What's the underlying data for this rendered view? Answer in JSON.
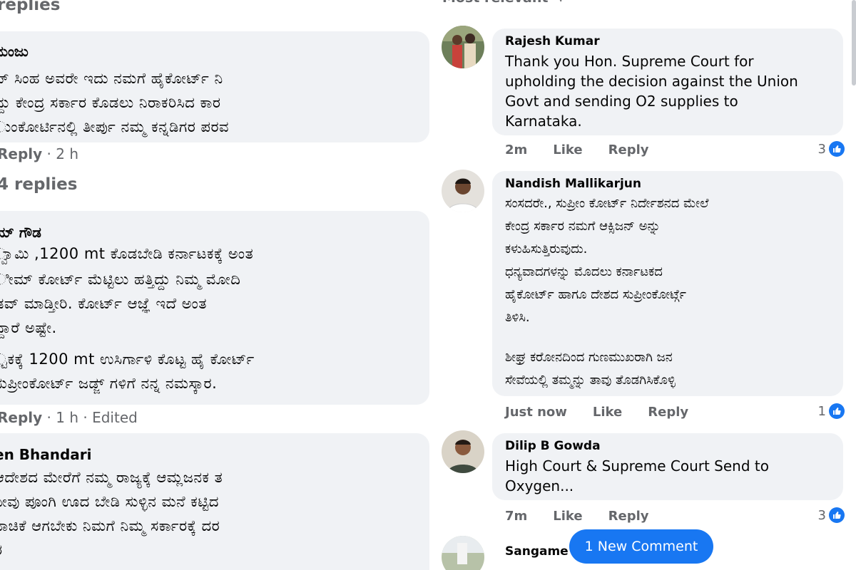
{
  "left": {
    "top_replies": "replies",
    "comment1": {
      "name": "ಮಂಜು",
      "lines": [
        "ಪ್ ಸಿಂಹ ಅವರೇ ಇದು ನಮಗೆ ಹೈಕೋರ್ಟ್ ನಿ",
        "ದ್ದು ಕೇಂದ್ರ ಸರ್ಕಾರ ಕೊಡಲು ನಿರಾಕರಿಸಿದ ಕಾರ",
        "ುಂಕೋರ್ಟಿನಲ್ಲಿ ತೀರ್ಪು ನಮ್ಮ ಕನ್ನಡಿಗರ ಪರವ"
      ],
      "reply": "Reply",
      "time": "· 2 h"
    },
    "replies2": "4 replies",
    "comment2": {
      "name": "ಯ್ ಗೌಡ",
      "lines": [
        "್ವಾಮಿ ,1200 mt ಕೊಡಬೇಡಿ ಕರ್ನಾಟಕಕ್ಕೆ ಅಂತ",
        "ೀಮ್ ಕೋರ್ಟ್ ಮೆಟ್ಟಿಲು ಹತ್ತಿದ್ದು ನಿಮ್ಮ ಮೋದಿ",
        "ಡವ್ ಮಾಡ್ತೀರಿ. ಕೋರ್ಟ್ ಆಜ್ಞೆ ಇದೆ ಅಂತ",
        "ದ್ದಾರೆ ಅಷ್ಟೇ.",
        "",
        "್ಟಕಕ್ಕೆ 1200 mt ಉಸಿರ್ಗಾಳಿ ಕೊಟ್ಟ ಹೈ ಕೋರ್ಟ್",
        "ಸುಪ್ರೀಂಕೋರ್ಟ್ ಜಡ್ಜ್ ಗಳಿಗೆ ನನ್ನ ನಮಸ್ಕಾರ."
      ],
      "reply": "Reply",
      "time": "· 1 h · Edited"
    },
    "comment3": {
      "name": "en Bhandari",
      "lines": [
        "ಆದೇಶದ ಮೇರೆಗೆ ನಮ್ಮ ರಾಜ್ಯಕ್ಕೆ ಆಮ್ಲಜನಕ ತ",
        "ನೀವು ಪೂಂಗಿ ಊದ ಬೇಡಿ ಸುಳ್ಳಿನ ಮನೆ ಕಟ್ಟಿದ",
        "ನಾಚಿಕೆ ಆಗಬೇಕು ನಿಮಗೆ ನಿಮ್ಮ ಸರ್ಕಾರಕ್ಕೆ ದರ",
        "ರ"
      ]
    }
  },
  "right": {
    "sort_label": "Most relevant",
    "comments": [
      {
        "name": "Rajesh Kumar",
        "lines": [
          "Thank you Hon. Supreme Court for",
          "upholding the decision against the Union",
          "Govt and sending O2 supplies to",
          "Karnataka."
        ],
        "time": "2m",
        "like": "Like",
        "reply": "Reply",
        "likes": "3"
      },
      {
        "name": "Nandish Mallikarjun",
        "lines": [
          "ಸಂಸದರೇ., ಸುಪ್ರೀಂ ಕೋರ್ಟ್ ನಿರ್ದೇಶನದ ಮೇಲೆ",
          "ಕೇಂದ್ರ ಸರ್ಕಾರ ನಮಗೆ ಆಕ್ಸಿಜನ್ ಅನ್ನು",
          "ಕಳುಹಿಸುತ್ತಿರುವುದು.",
          "ಧನ್ಯವಾದಗಳನ್ನು ಮೊದಲು ಕರ್ನಾಟಕದ",
          "ಹೈಕೋರ್ಟ್ ಹಾಗೂ ದೇಶದ ಸುಪ್ರೀಂಕೋರ್ಟ್ಗೆ",
          "ತಿಳಿಸಿ.",
          "",
          "ಶೀಘ್ರ ಕರೋನದಿಂದ ಗುಣಮುಖರಾಗಿ ಜನ",
          "ಸೇವೆಯಲ್ಲಿ ತಮ್ಮನ್ನು ತಾವು ತೊಡಗಿಸಿಕೊಳ್ಳಿ"
        ],
        "time": "Just now",
        "like": "Like",
        "reply": "Reply",
        "likes": "1"
      },
      {
        "name": "Dilip B Gowda",
        "lines": [
          "High Court & Supreme Court Send to",
          "Oxygen..."
        ],
        "time": "7m",
        "like": "Like",
        "reply": "Reply",
        "likes": "3"
      }
    ],
    "partial_name": "Sangame",
    "new_comment_button": "1 New Comment"
  },
  "colors": {
    "accent": "#1877f2",
    "bubble": "#f0f2f5",
    "meta": "#65676b"
  },
  "icons": [
    "like-thumb-icon",
    "chevron-down-icon"
  ]
}
